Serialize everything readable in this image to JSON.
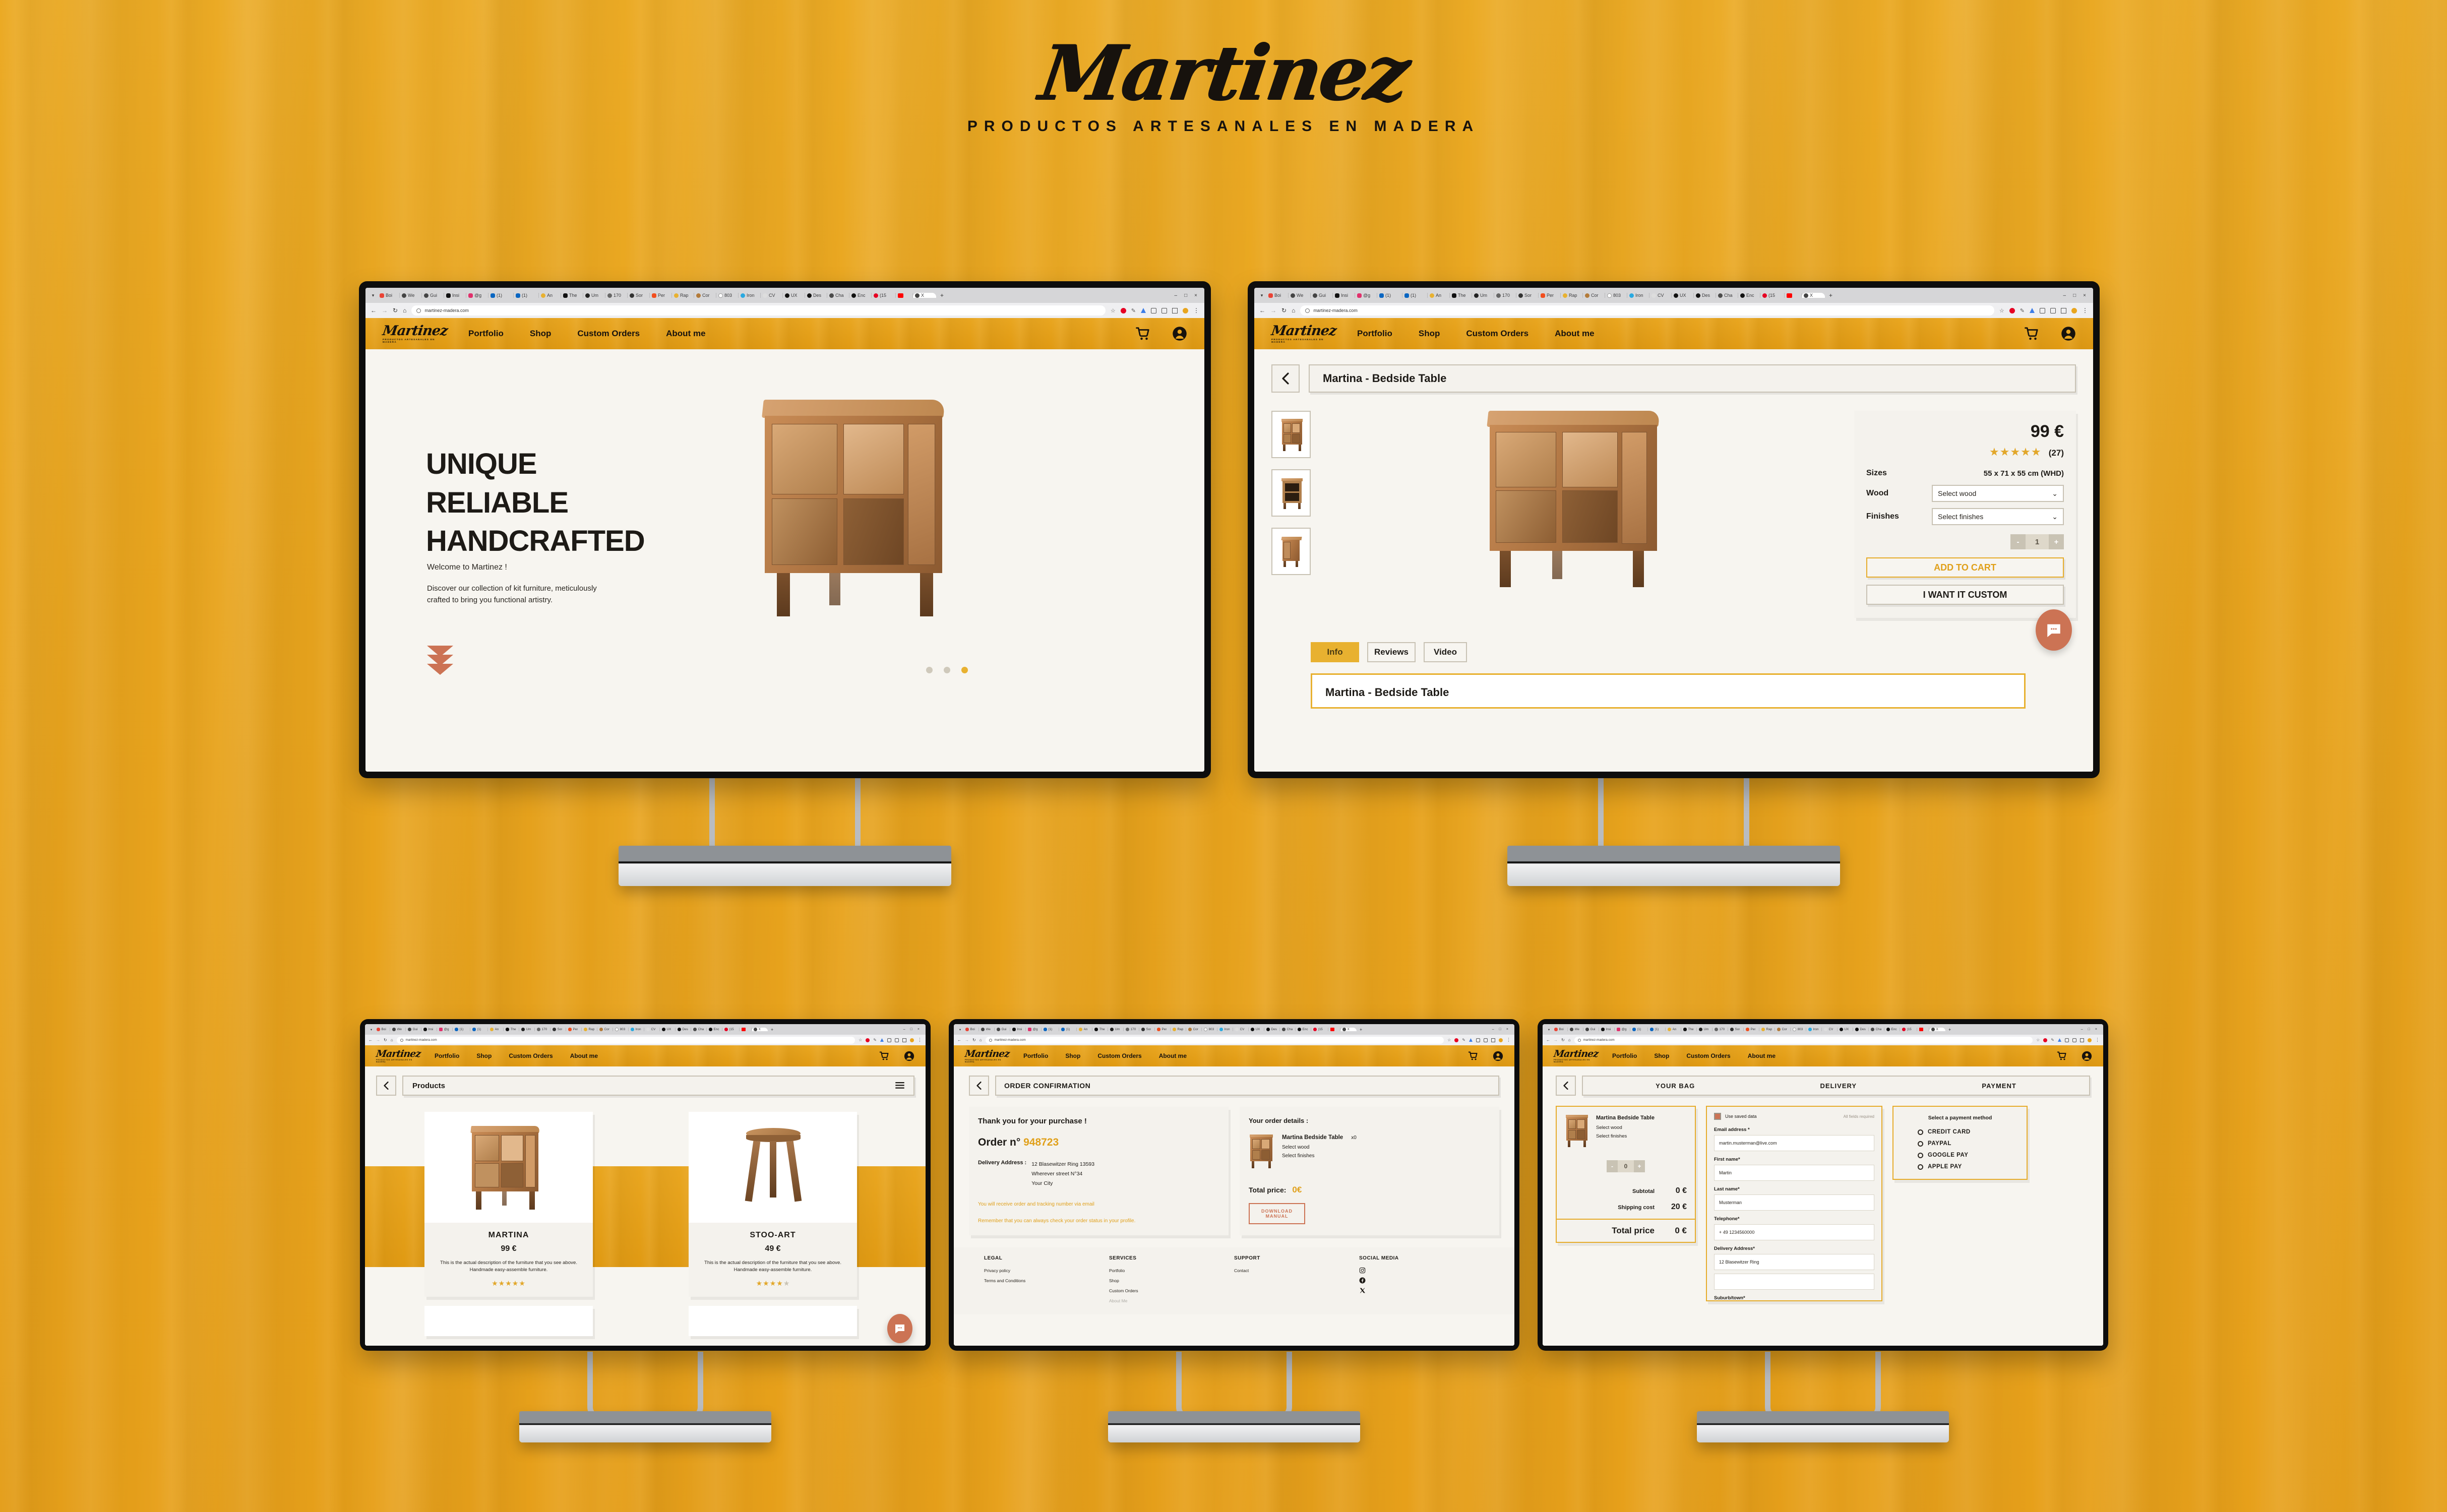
{
  "brand": {
    "name": "Martinez",
    "tagline": "PRODUCTOS ARTESANALES EN MADERA"
  },
  "accent_colors": {
    "wood_background": "#E8A51F",
    "nav_gold": "#E9A620",
    "gold_text": "#E0A01A",
    "terracotta": "#CC7354",
    "cream": "#F4F2ED",
    "dark": "#1d1a16"
  },
  "browser": {
    "url": "martinez-madera.com",
    "back_icon": "arrow-left-icon",
    "forward_icon": "arrow-right-icon",
    "reload_icon": "reload-icon",
    "home_icon": "home-icon",
    "info_icon": "site-info-icon",
    "bookmark_icon": "star-icon",
    "menu_icon": "kebab-menu-icon",
    "new_tab_label": "+",
    "minimize_label": "–",
    "maximize_label": "□",
    "close_label": "×",
    "tabs": [
      {
        "label": "Boi"
      },
      {
        "label": "We"
      },
      {
        "label": "Gui"
      },
      {
        "label": "Insi"
      },
      {
        "label": "@g"
      },
      {
        "label": "(1)"
      },
      {
        "label": "(1)"
      },
      {
        "label": "An"
      },
      {
        "label": "The"
      },
      {
        "label": "Um"
      },
      {
        "label": "170"
      },
      {
        "label": "Sor"
      },
      {
        "label": "Per"
      },
      {
        "label": "Rap"
      },
      {
        "label": "Cor"
      },
      {
        "label": "803"
      },
      {
        "label": "Iron"
      },
      {
        "label": "CV"
      },
      {
        "label": "UX"
      },
      {
        "label": "Des"
      },
      {
        "label": "Cha"
      },
      {
        "label": "Enc"
      },
      {
        "label": "(15"
      },
      {
        "label": ""
      },
      {
        "label": "X"
      }
    ]
  },
  "site_nav": {
    "logo_script": "Martinez",
    "logo_sub": "PRODUCTOS ARTESANALES EN MADERA",
    "links": [
      "Portfolio",
      "Shop",
      "Custom Orders",
      "About me"
    ],
    "cart_icon": "shopping-cart-icon",
    "account_icon": "user-account-icon"
  },
  "screen_home": {
    "headline_lines": [
      "UNIQUE",
      "RELIABLE",
      "HANDCRAFTED"
    ],
    "welcome": "Welcome to Martinez !",
    "body": "Discover our collection of kit furniture, meticulously crafted to bring you functional artistry.",
    "scroll_icon": "triple-chevron-down-icon",
    "carousel_dots": [
      false,
      false,
      true
    ],
    "hero_image_alt": "martina-bedside-table-photo"
  },
  "screen_product": {
    "back_icon": "chevron-left-icon",
    "title": "Martina - Bedside Table",
    "thumbnails": [
      "thumb-front-view",
      "thumb-open-view",
      "thumb-angle-view"
    ],
    "price": "99 €",
    "rating_stars": 5,
    "rating_count": "(27)",
    "specs": [
      {
        "label": "Sizes",
        "value": "55 x 71 x 55 cm (WHD)"
      }
    ],
    "selects": [
      {
        "label": "Wood",
        "value": "Select wood"
      },
      {
        "label": "Finishes",
        "value": "Select finishes"
      }
    ],
    "qty": {
      "minus": "-",
      "value": "1",
      "plus": "+"
    },
    "add_to_cart_label": "ADD TO CART",
    "custom_label": "I WANT IT CUSTOM",
    "tabs": [
      {
        "label": "Info",
        "active": true
      },
      {
        "label": "Reviews",
        "active": false
      },
      {
        "label": "Video",
        "active": false
      }
    ],
    "info_panel_title": "Martina - Bedside Table",
    "chat_icon": "chat-bubble-icon"
  },
  "screen_products": {
    "back_icon": "chevron-left-icon",
    "title": "Products",
    "filter_icon": "hamburger-filter-icon",
    "items": [
      {
        "name": "MARTINA",
        "price": "99 €",
        "description": "This is the actual description of the furniture that you see above. Handmade easy-assemble furniture.",
        "stars": 5,
        "image_alt": "martina-bedside-table-photo"
      },
      {
        "name": "STOO-ART",
        "price": "49 €",
        "description": "This is the actual description of the furniture that you see above. Handmade easy-assemble furniture.",
        "stars": 4,
        "image_alt": "stoo-art-stool-photo"
      }
    ],
    "chat_icon": "chat-bubble-icon"
  },
  "screen_confirmation": {
    "back_icon": "chevron-left-icon",
    "title": "ORDER CONFIRMATION",
    "thanks": "Thank you for your purchase !",
    "order_label": "Order n°",
    "order_number": "948723",
    "address_label": "Delivery Address :",
    "address_lines": [
      "12 Blasewitzer Ring 13593",
      "Wherever street N°34",
      "Your City"
    ],
    "note_1": "You will receive order and tracking number via email",
    "note_2": "Remember that you can always check your order status in your profile.",
    "details_title": "Your order details :",
    "item_name": "Martina Bedside Table",
    "item_qty": "x0",
    "item_opt_1": "Select wood",
    "item_opt_2": "Select finishes",
    "total_label": "Total price:",
    "total_value": "0€",
    "download_label": "DOWNLOAD MANUAL",
    "footer": {
      "columns": [
        {
          "heading": "LEGAL",
          "links": [
            "Privacy policy",
            "Terms and Conditions"
          ]
        },
        {
          "heading": "SERVICES",
          "links": [
            "Portfolio",
            "Shop",
            "Custom Orders",
            "About Me"
          ]
        },
        {
          "heading": "SUPPORT",
          "links": [
            "Contact"
          ]
        },
        {
          "heading": "SOCIAL MEDIA",
          "links": []
        }
      ],
      "social_icons": [
        "instagram-icon",
        "facebook-icon",
        "x-twitter-icon"
      ]
    }
  },
  "screen_checkout": {
    "back_icon": "chevron-left-icon",
    "steps": [
      "YOUR BAG",
      "DELIVERY",
      "PAYMENT"
    ],
    "bag": {
      "item_name": "Martina Bedside Table",
      "item_opt_1": "Select wood",
      "item_opt_2": "Select finishes",
      "qty": {
        "minus": "-",
        "value": "0",
        "plus": "+"
      },
      "rows": [
        {
          "label": "Subtotal",
          "value": "0 €"
        },
        {
          "label": "Shipping cost",
          "value": "20 €"
        }
      ],
      "total_label": "Total price",
      "total_value": "0 €"
    },
    "delivery": {
      "saved_data_label": "Use saved data",
      "saved_data_checked": true,
      "required_note": "All fields required",
      "fields": [
        {
          "label": "Email address *",
          "value": "martin.musterman@live.com"
        },
        {
          "label": "First name*",
          "value": "Martin"
        },
        {
          "label": "Last name*",
          "value": "Musterman"
        },
        {
          "label": "Telephone*",
          "value": "+ 49 1234560000"
        },
        {
          "label": "Delivery Address*",
          "value": "12 Blasewitzer Ring"
        },
        {
          "label": "",
          "value": ""
        },
        {
          "label": "Suburb/town*",
          "value": ""
        }
      ]
    },
    "payment": {
      "heading": "Select a payment method",
      "methods": [
        "CREDIT CARD",
        "PAYPAL",
        "GOOGLE PAY",
        "APPLE PAY"
      ]
    }
  }
}
